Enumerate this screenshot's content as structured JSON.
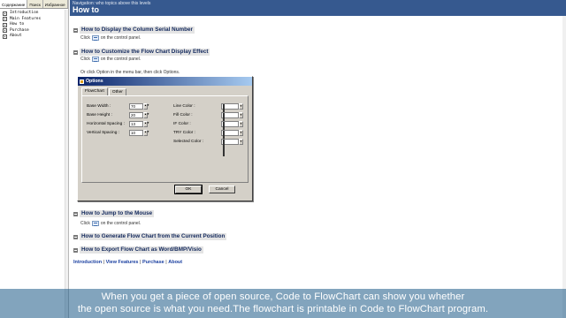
{
  "left_pane": {
    "tabs": [
      "Содержание",
      "Поиск",
      "Избранное"
    ],
    "tree_items": [
      "Introduction",
      "Main Features",
      "How to",
      "Purchase",
      "About"
    ]
  },
  "header": {
    "navigation": "Navigation: who topics above this levels",
    "title": "How to"
  },
  "sections": {
    "display_serial": {
      "title": "How to Display the Column Serial Number",
      "text_before": "Click",
      "icon": "serial-number-toolbar-icon",
      "text_after": "on the control panel."
    },
    "customize": {
      "title": "How to Customize the Flow Chart Display Effect",
      "text_before": "Click",
      "icon": "options-toolbar-icon",
      "text_after": "on the control panel.",
      "or_text": "Or click Option in the menu bar, then click Options."
    },
    "jump": {
      "title": "How to Jump to the Mouse",
      "text_before": "Click",
      "icon": "jump-mouse-toolbar-icon",
      "text_after": "on the control panel."
    },
    "generate": {
      "title": "How to Generate Flow Chart from the Current Position"
    },
    "export": {
      "title": "How to Export Flow Chart as Word/BMP/Visio"
    }
  },
  "dialog": {
    "title": "Options",
    "tabs": [
      "FlowChart",
      "Other"
    ],
    "fields": [
      {
        "label": "Base Width :",
        "value": "70"
      },
      {
        "label": "Base Height :",
        "value": "20"
      },
      {
        "label": "Horizontal Spacing :",
        "value": "13"
      },
      {
        "label": "Vertical Spacing :",
        "value": "10"
      }
    ],
    "colors": [
      {
        "label": "Line Color :",
        "color": "#6b1a12"
      },
      {
        "label": "Fill Color :",
        "color": "#ffffff"
      },
      {
        "label": "IF Color :",
        "color": "#e62ad4"
      },
      {
        "label": "TRY Color :",
        "color": "#b8b8b8"
      },
      {
        "label": "Selected Color :",
        "color": "#18c8c8"
      }
    ],
    "ok_label": "OK",
    "cancel_label": "Cancel"
  },
  "footer": {
    "links": [
      "Introduction",
      "View Features",
      "Purchase",
      "About"
    ],
    "separator": "|"
  },
  "subtitles": {
    "line1": "When you get a piece of open source, Code to FlowChart can show you whether",
    "line2": "the open source is what you need.The flowchart is printable in Code to FlowChart program."
  },
  "colors": {
    "header_bg": "#36598f",
    "section_title": "#12285c",
    "link": "#1a3fa0"
  }
}
